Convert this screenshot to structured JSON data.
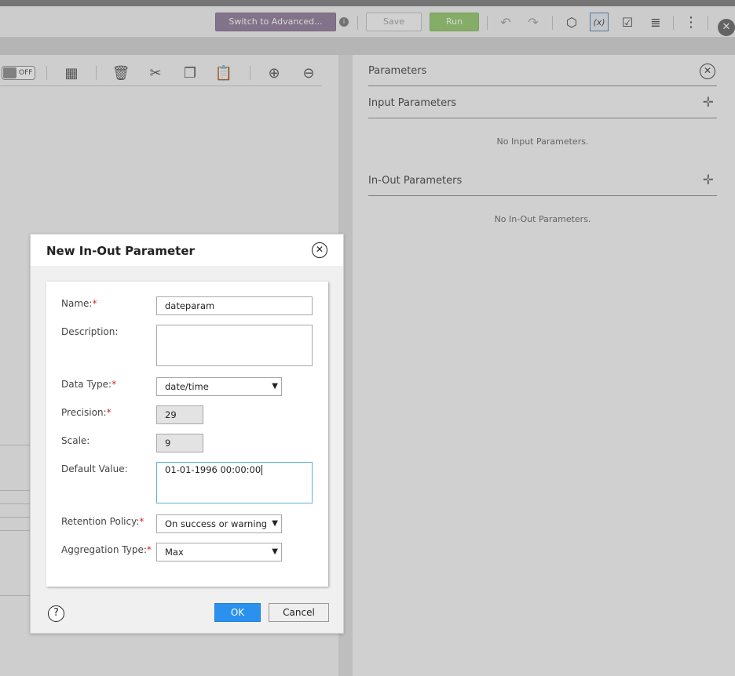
{
  "toolbar": {
    "switch_advanced": "Switch to Advanced...",
    "save": "Save",
    "run": "Run",
    "colors": {
      "advanced": "#9b8aa5",
      "run": "#9fcf7d"
    }
  },
  "canvas_toolbar": {
    "toggle_label": "OFF"
  },
  "panel": {
    "title": "Parameters",
    "input_section": "Input Parameters",
    "input_empty": "No Input Parameters.",
    "inout_section": "In-Out Parameters",
    "inout_empty": "No In-Out Parameters."
  },
  "dialog": {
    "title": "New In-Out Parameter",
    "fields": {
      "name": {
        "label": "Name:",
        "value": "dateparam",
        "required": "*"
      },
      "description": {
        "label": "Description:",
        "value": ""
      },
      "data_type": {
        "label": "Data Type:",
        "value": "date/time",
        "required": "*"
      },
      "precision": {
        "label": "Precision:",
        "value": "29",
        "required": "*"
      },
      "scale": {
        "label": "Scale:",
        "value": "9"
      },
      "default_value": {
        "label": "Default Value:",
        "value": "01-01-1996 00:00:00"
      },
      "retention_policy": {
        "label": "Retention Policy:",
        "value": "On success or warning",
        "required": "*"
      },
      "aggregation_type": {
        "label": "Aggregation Type:",
        "value": "Max",
        "required": "*"
      }
    },
    "help": "?",
    "ok": "OK",
    "cancel": "Cancel",
    "colors": {
      "primary": "#2b91ef",
      "required": "#d42626",
      "focus": "#5ab1d8"
    }
  },
  "icons": [
    "info-icon",
    "undo-icon",
    "redo-icon",
    "validate-icon",
    "parameters-icon",
    "checkmark-icon",
    "properties-icon",
    "more-vertical-icon",
    "close-icon",
    "grid-icon",
    "delete-icon",
    "cut-icon",
    "copy-icon",
    "paste-icon",
    "zoom-in-icon",
    "zoom-out-icon",
    "add-icon",
    "help-icon",
    "dropdown-caret-icon"
  ]
}
